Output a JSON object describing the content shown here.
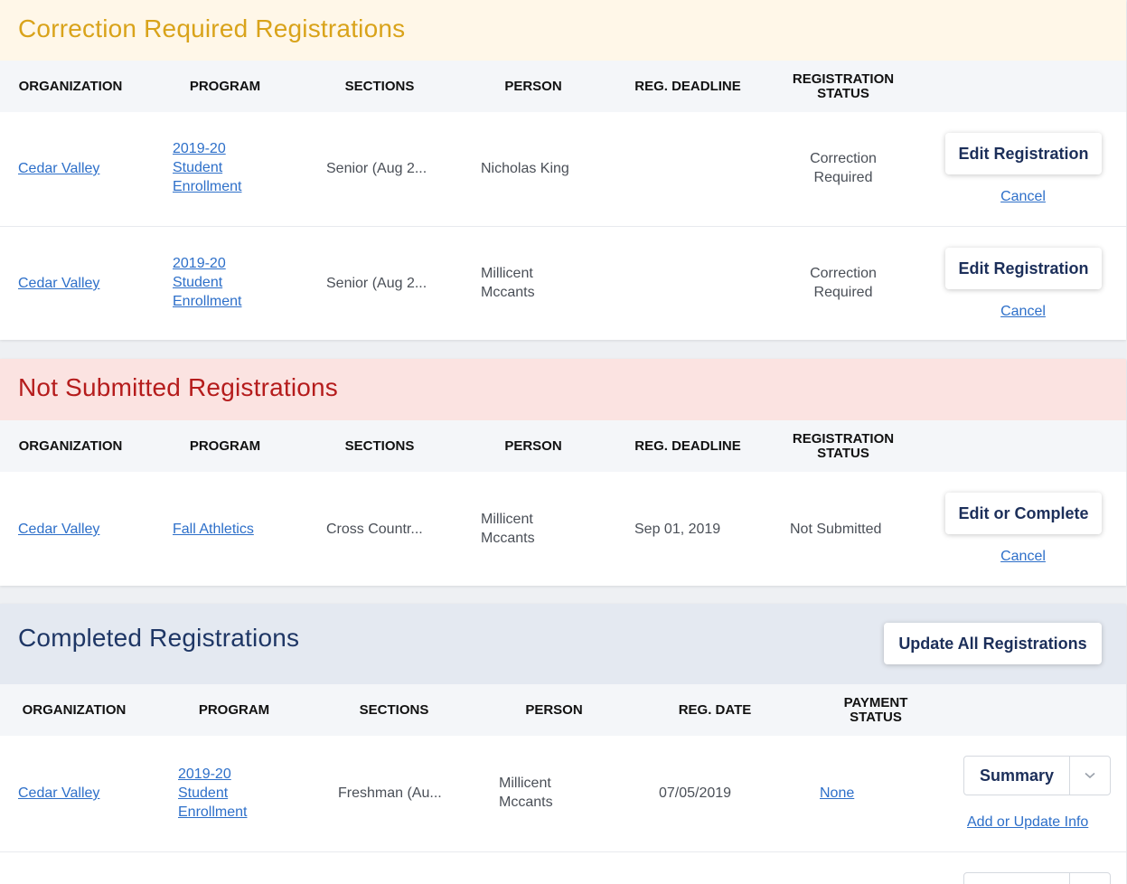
{
  "correction": {
    "title": "Correction Required Registrations",
    "headers": [
      "ORGANIZATION",
      "PROGRAM",
      "SECTIONS",
      "PERSON",
      "REG. DEADLINE",
      "REGISTRATION STATUS"
    ],
    "rows": [
      {
        "organization": "Cedar Valley",
        "program": "2019-20 Student Enrollment",
        "sections": "Senior (Aug 2...",
        "person": "Nicholas King",
        "deadline": "",
        "status": "Correction Required",
        "action": "Edit Registration",
        "cancel": "Cancel"
      },
      {
        "organization": "Cedar Valley",
        "program": "2019-20 Student Enrollment",
        "sections": "Senior (Aug 2...",
        "person": "Millicent Mccants",
        "deadline": "",
        "status": "Correction Required",
        "action": "Edit Registration",
        "cancel": "Cancel"
      }
    ]
  },
  "not_submitted": {
    "title": "Not Submitted Registrations",
    "headers": [
      "ORGANIZATION",
      "PROGRAM",
      "SECTIONS",
      "PERSON",
      "REG. DEADLINE",
      "REGISTRATION STATUS"
    ],
    "rows": [
      {
        "organization": "Cedar Valley",
        "program": "Fall Athletics",
        "sections": "Cross Countr...",
        "person": "Millicent Mccants",
        "deadline": "Sep 01, 2019",
        "status": "Not Submitted",
        "action": "Edit or Complete",
        "cancel": "Cancel"
      }
    ]
  },
  "completed": {
    "title": "Completed Registrations",
    "update_all": "Update All Registrations",
    "headers": [
      "ORGANIZATION",
      "PROGRAM",
      "SECTIONS",
      "PERSON",
      "REG. DATE",
      "PAYMENT STATUS"
    ],
    "rows": [
      {
        "organization": "Cedar Valley",
        "program": "2019-20 Student Enrollment",
        "sections": "Freshman (Au...",
        "person": "Millicent Mccants",
        "reg_date": "07/05/2019",
        "payment": "None",
        "action": "Summary",
        "extra": "Add or Update Info"
      }
    ]
  },
  "icons": {
    "dropdown": "chevron-down-icon"
  },
  "colors": {
    "correction_bg": "#fff7e8",
    "correction_title": "#d9a31a",
    "not_submitted_bg": "#fbe3e1",
    "not_submitted_title": "#b51c1c",
    "completed_bg": "#e4e9f1",
    "completed_title": "#1e3665",
    "link": "#2d6fc9",
    "button_text": "#1c2f5a"
  }
}
